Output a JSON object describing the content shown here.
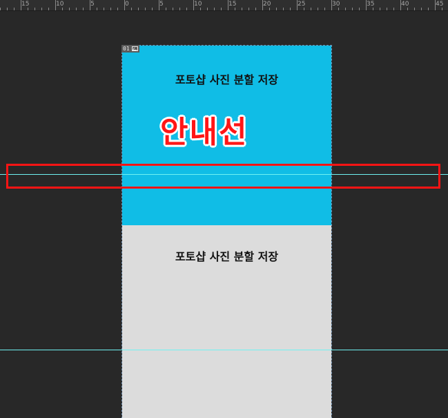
{
  "ruler": {
    "labels": [
      "15",
      "10",
      "5",
      "0",
      "5",
      "10",
      "15",
      "20",
      "25",
      "30",
      "35",
      "40",
      "45"
    ]
  },
  "artboard": {
    "top_slice": {
      "tag": "01",
      "title": "포토샵 사진 분할 저장",
      "color": "#10bde6"
    },
    "bottom_slice": {
      "title": "포토샵 사진 분할 저장",
      "color": "#dcdcdc"
    }
  },
  "annotation": {
    "text": "안내선",
    "color": "#ff1616"
  },
  "guides": {
    "color": "#6ff2f2",
    "count": 2
  },
  "highlight": {
    "color": "#ff1414"
  }
}
